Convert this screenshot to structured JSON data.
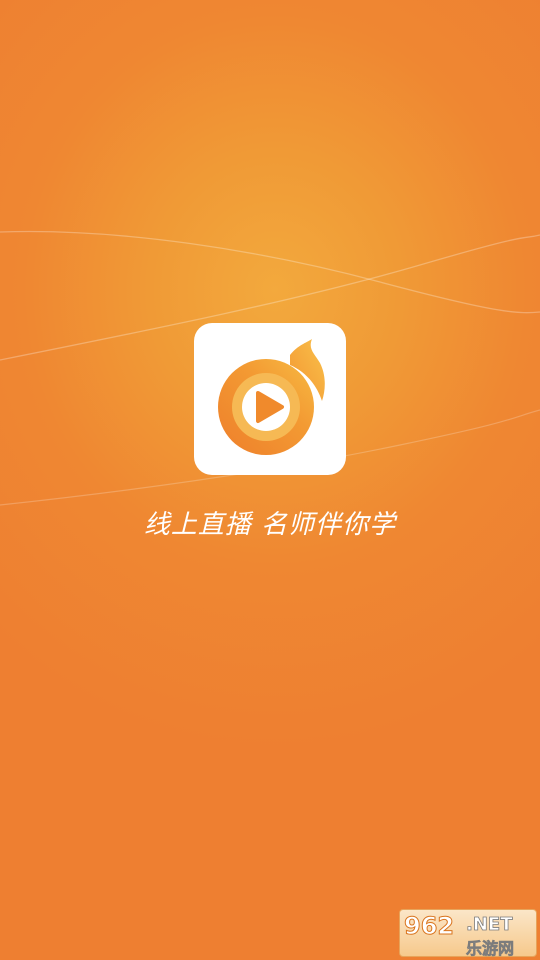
{
  "splash": {
    "slogan": "线上直播 名师伴你学",
    "background_color": "#ef8732",
    "glow_color": "#f3a93d"
  },
  "app_icon": {
    "icon_name": "flame-play-logo-icon",
    "primary_color": "#f08a2c",
    "accent_color": "#f5b43c"
  },
  "watermark": {
    "number": "962",
    "suffix": ".NET",
    "site_name": "乐游网"
  }
}
